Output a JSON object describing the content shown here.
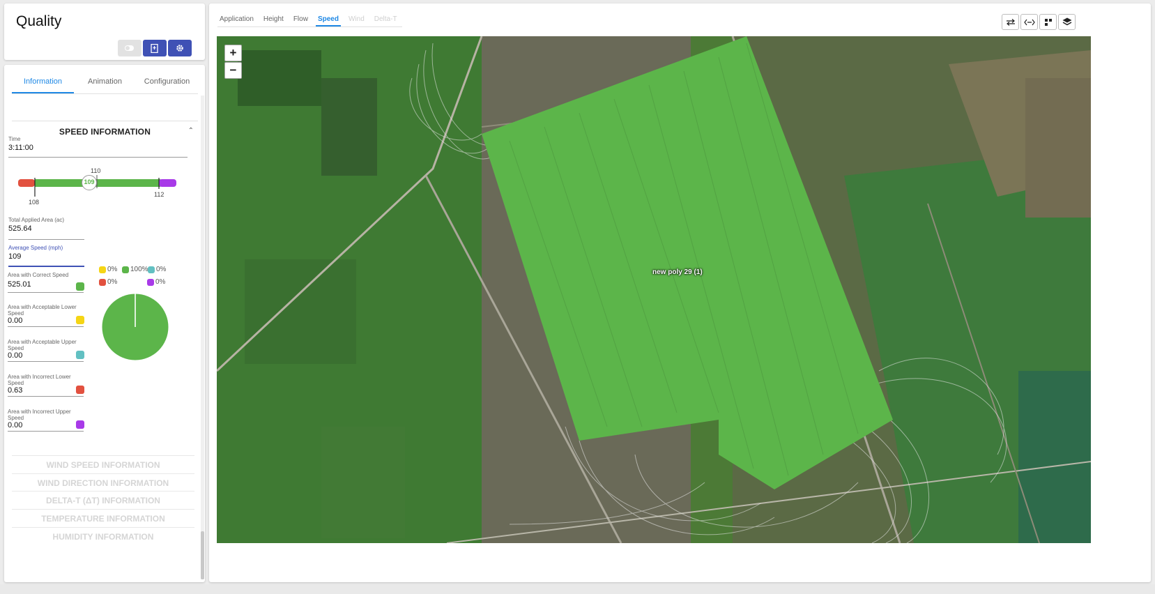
{
  "header": {
    "title": "Quality"
  },
  "tabs": {
    "info": "Information",
    "animation": "Animation",
    "configuration": "Configuration"
  },
  "speed": {
    "section_title": "SPEED INFORMATION",
    "time_label": "Time",
    "time_value": "3:11:00",
    "gauge": {
      "current": "109",
      "tick_top": "110",
      "tick_low": "108",
      "tick_high": "112"
    },
    "total_area_label": "Total Applied Area (ac)",
    "total_area_value": "525.64",
    "avg_speed_label": "Average Speed (mph)",
    "avg_speed_value": "109",
    "rows": [
      {
        "label": "Area with Correct Speed",
        "value": "525.01",
        "color": "#5cb54a"
      },
      {
        "label": "Area with Acceptable Lower Speed",
        "value": "0.00",
        "color": "#f5d515"
      },
      {
        "label": "Area with Acceptable Upper Speed",
        "value": "0.00",
        "color": "#62c0c2"
      },
      {
        "label": "Area with Incorrect Lower Speed",
        "value": "0.63",
        "color": "#e2513f"
      },
      {
        "label": "Area with Incorrect Upper Speed",
        "value": "0.00",
        "color": "#a83ae8"
      }
    ],
    "legend": {
      "yellow": "0%",
      "green": "100%",
      "teal": "0%",
      "red": "0%",
      "purple": "0%"
    }
  },
  "collapsed_sections": [
    "WIND SPEED INFORMATION",
    "WIND DIRECTION INFORMATION",
    "DELTA-T (ΔT) INFORMATION",
    "TEMPERATURE INFORMATION",
    "HUMIDITY INFORMATION"
  ],
  "map_tabs": {
    "application": "Application",
    "height": "Height",
    "flow": "Flow",
    "speed": "Speed",
    "wind": "Wind",
    "delta_t": "Delta-T"
  },
  "map": {
    "zoom_in": "+",
    "zoom_out": "−",
    "polygon_label": "new poly 29 (1)"
  },
  "colors": {
    "accent": "#1e88e5",
    "button_blue": "#3f51b5",
    "coverage_green": "#5cb54a"
  }
}
